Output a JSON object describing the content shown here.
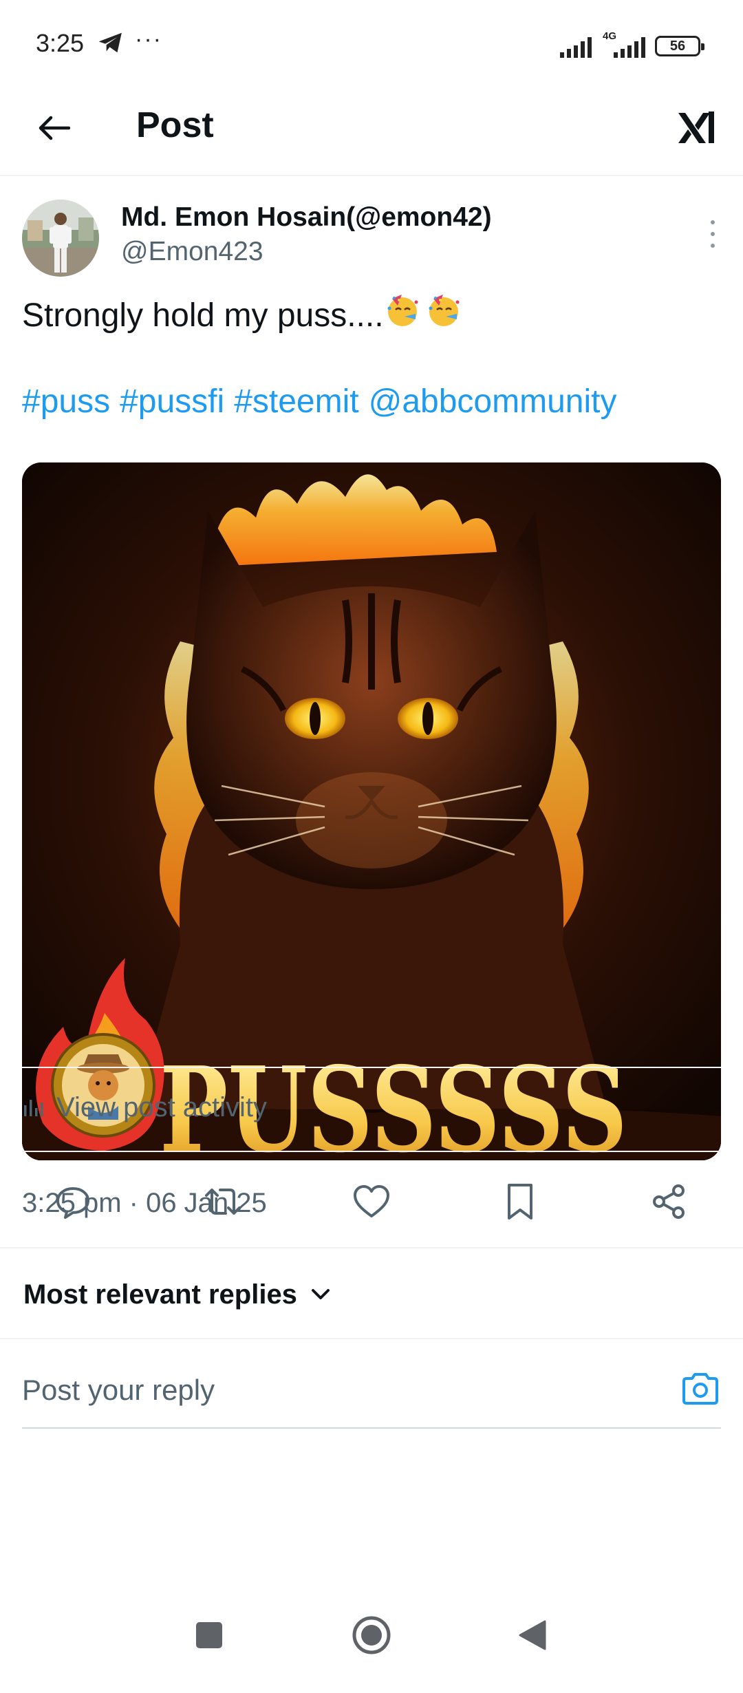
{
  "status_bar": {
    "time": "3:25",
    "overflow_dots": "···",
    "network_type": "4G",
    "battery": "56"
  },
  "header": {
    "title": "Post"
  },
  "post": {
    "author_name": "Md. Emon Hosain(@emon42)",
    "author_handle": "@Emon423",
    "text": "Strongly hold my puss....",
    "emoji": "partying-face",
    "hashtags": [
      "#puss",
      "#pussfi",
      "#steemit",
      "@abbcommunity"
    ],
    "image_caption": "PUSSSSS",
    "timestamp": "3:25 pm · 06 Jan 25",
    "view_activity_label": "View post activity"
  },
  "replies": {
    "sort_label": "Most relevant replies",
    "reply_placeholder": "Post your reply"
  },
  "colors": {
    "link_blue": "#1d9bf0",
    "secondary_text": "#536471",
    "divider": "#eff3f4",
    "primary_text": "#0f1419"
  },
  "icons": {
    "back": "arrow-left-icon",
    "logo": "xai-logo-icon",
    "more": "more-vertical-icon",
    "reply": "reply-icon",
    "repost": "repost-icon",
    "like": "heart-icon",
    "bookmark": "bookmark-icon",
    "share": "share-icon",
    "camera": "camera-icon"
  }
}
